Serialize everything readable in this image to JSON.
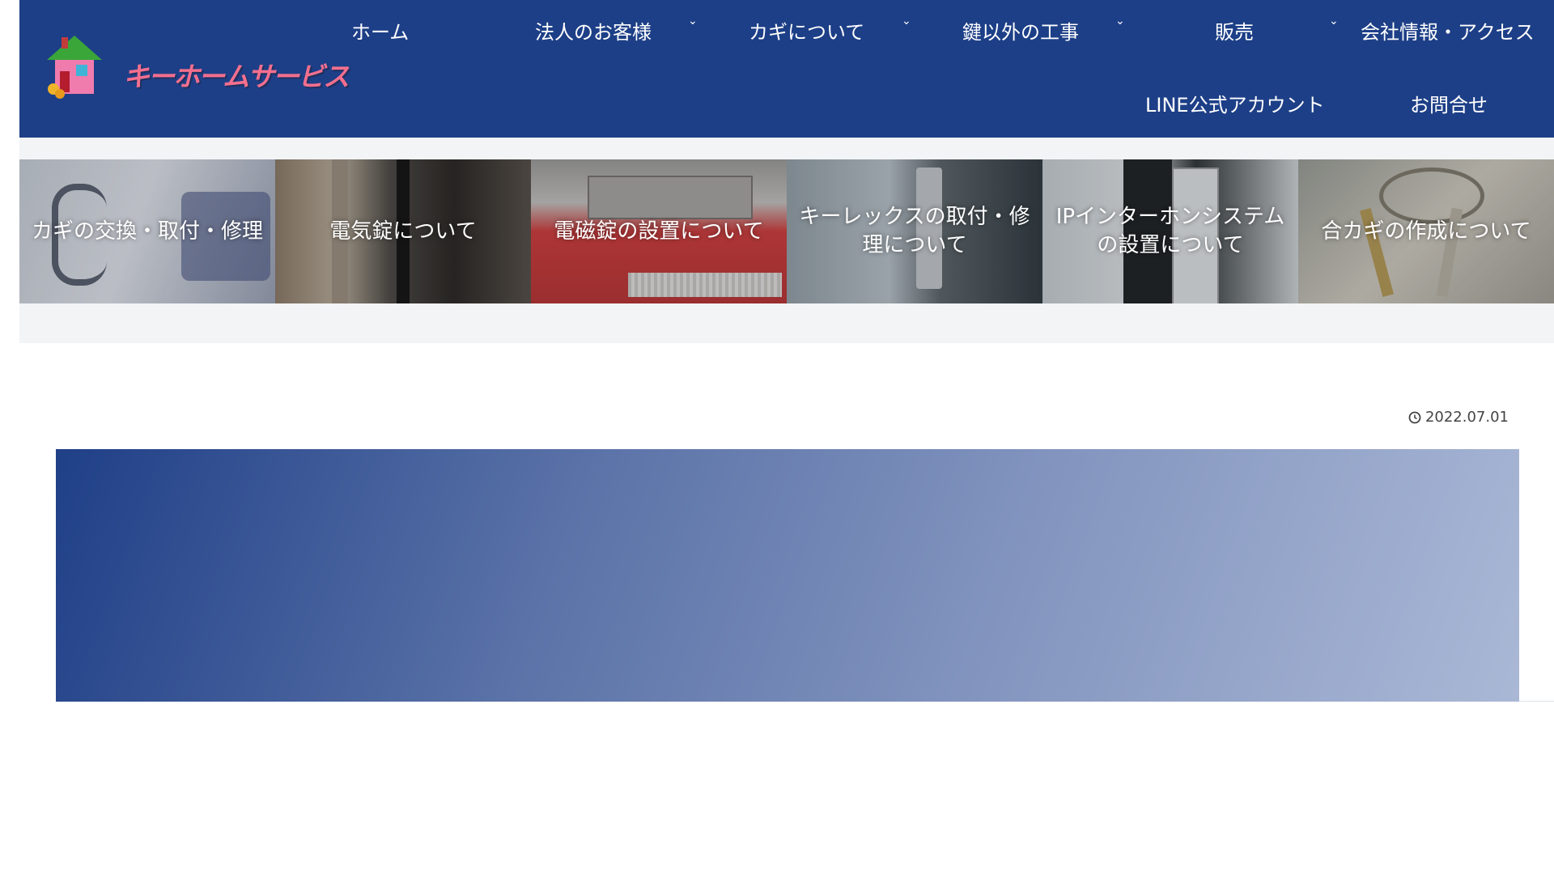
{
  "header": {
    "logo_text": "キーホームサービス",
    "nav": [
      {
        "label": "ホーム",
        "has_dropdown": false
      },
      {
        "label": "法人のお客様",
        "has_dropdown": true
      },
      {
        "label": "カギについて",
        "has_dropdown": true
      },
      {
        "label": "鍵以外の工事",
        "has_dropdown": true
      },
      {
        "label": "販売",
        "has_dropdown": true
      },
      {
        "label": "会社情報・アクセス",
        "has_dropdown": false
      },
      {
        "label": "LINE公式アカウント",
        "has_dropdown": false
      },
      {
        "label": "お問合せ",
        "has_dropdown": false
      }
    ],
    "caret_glyph": "⌄"
  },
  "categories": [
    {
      "label": "カギの交換・取付・修理"
    },
    {
      "label": "電気錠について"
    },
    {
      "label": "電磁錠の設置について"
    },
    {
      "label": "キーレックスの取付・修理について"
    },
    {
      "label": "IPインターホンシステムの設置について"
    },
    {
      "label": "合カギの作成について"
    }
  ],
  "post": {
    "date": "2022.07.01"
  },
  "colors": {
    "header_bg": "#1d3f87",
    "band_bg": "#f2f4f5"
  }
}
